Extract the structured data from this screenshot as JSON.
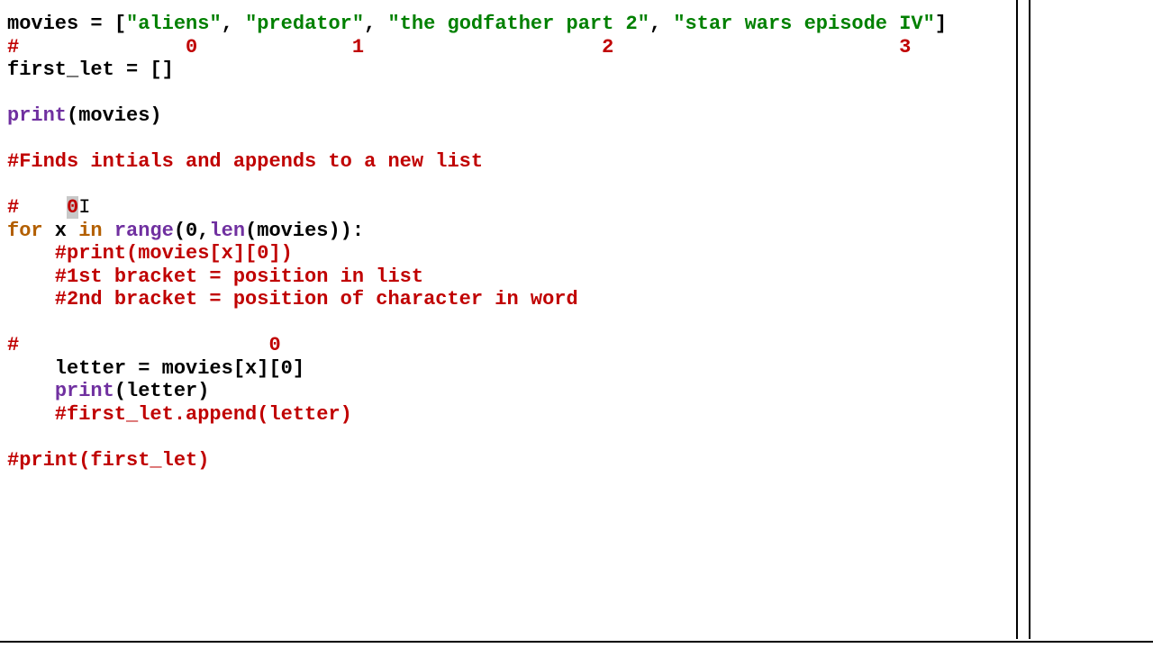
{
  "code": {
    "line1_name": "movies",
    "line1_eq": " = [",
    "line1_s1": "\"aliens\"",
    "line1_c1": ", ",
    "line1_s2": "\"predator\"",
    "line1_c2": ", ",
    "line1_s3": "\"the godfather part 2\"",
    "line1_c3": ", ",
    "line1_s4": "\"star wars episode IV\"",
    "line1_end": "]",
    "line2": "#              0             1                    2                        3",
    "line3": "first_let = []",
    "line4_pre": "(movies)",
    "line4_print": "print",
    "line5": "#Finds intials and appends to a new list",
    "line6_hash": "#    ",
    "line6_zero": "0",
    "line7_for": "for",
    "line7_x": " x ",
    "line7_in": "in",
    "line7_sp": " ",
    "line7_range": "range",
    "line7_open": "(",
    "line7_zero": "0",
    "line7_comma": ",",
    "line7_len": "len",
    "line7_tail": "(movies)):",
    "line8": "    #print(movies[x][0])",
    "line9": "    #1st bracket = position in list",
    "line10": "    #2nd bracket = position of character in word",
    "line11": "#                     0",
    "line12_a": "    letter = movies[x][",
    "line12_zero": "0",
    "line12_b": "]",
    "line13_indent": "    ",
    "line13_print": "print",
    "line13_rest": "(letter)",
    "line14": "    #first_let.append(letter)",
    "line15": "#print(first_let)"
  },
  "cursor_glyph": "I"
}
